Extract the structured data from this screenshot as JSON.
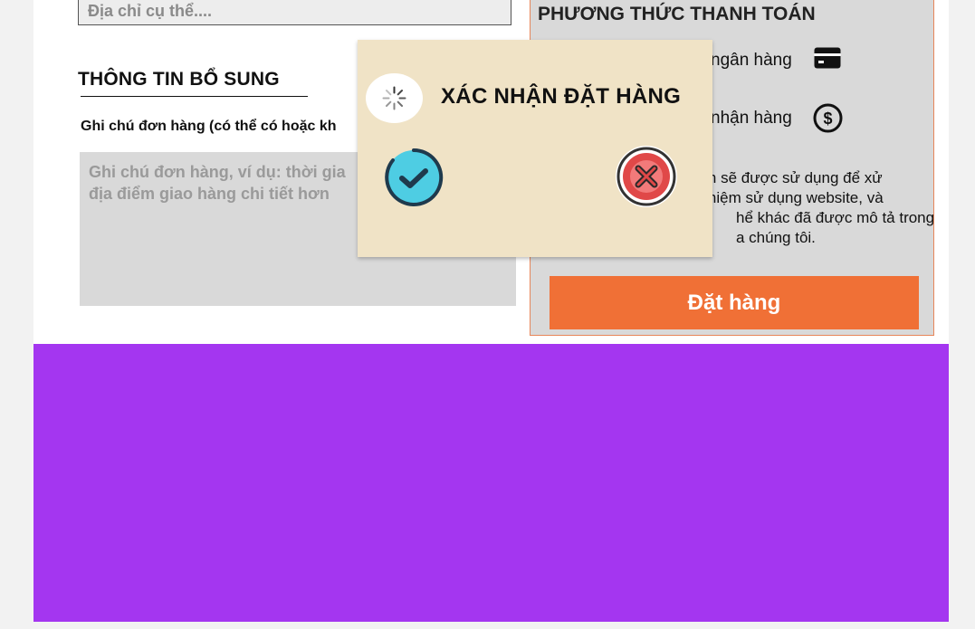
{
  "address": {
    "placeholder": "Địa chỉ cụ thể...."
  },
  "additional_info": {
    "title": "THÔNG TIN BỔ SUNG",
    "note_label": "Ghi chú đơn hàng (có thể có hoặc kh",
    "note_placeholder": "Ghi chú đơn hàng, ví dụ: thời gia\nđịa điểm giao hàng chi tiết hơn"
  },
  "payment": {
    "title": "PHƯƠNG THỨC THANH TOÁN",
    "options": [
      {
        "label": "ngân hàng",
        "icon": "credit-card-icon"
      },
      {
        "label": "nhận hàng",
        "icon": "dollar-circle-icon"
      }
    ],
    "privacy_lines": [
      "bạn sẽ được sử dụng để xử",
      "nghiệm sử dụng website, và",
      "hể khác đã được mô tả trong",
      "a chúng tôi."
    ],
    "order_button": "Đặt hàng"
  },
  "modal": {
    "title": "XÁC NHẬN ĐẶT HÀNG",
    "confirm_icon": "checkmark-circle-icon",
    "cancel_icon": "close-circle-icon",
    "loading_icon": "spinner-icon"
  },
  "colors": {
    "accent": "#f07036",
    "footer": "#a436f0",
    "modal_bg": "#f0e3c6",
    "confirm": "#4ecde3",
    "cancel": "#e04848"
  }
}
